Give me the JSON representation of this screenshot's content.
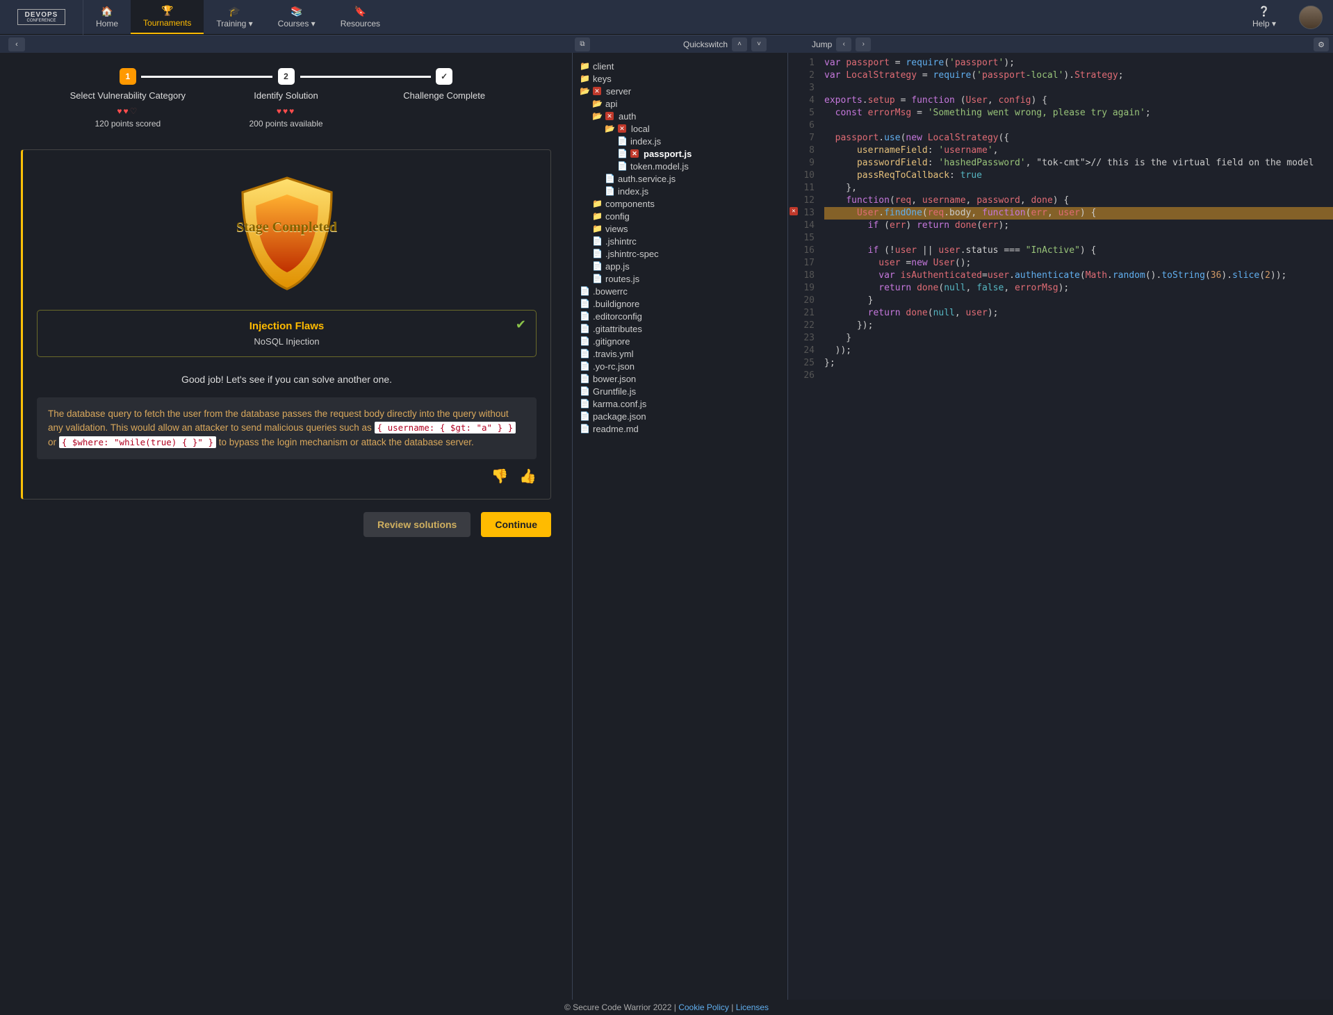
{
  "nav": {
    "logo_top": "DEVOPS",
    "logo_sub": "CONFERENCE",
    "items": [
      {
        "icon": "🏠",
        "label": "Home"
      },
      {
        "icon": "🏆",
        "label": "Tournaments",
        "active": true
      },
      {
        "icon": "🎓",
        "label": "Training ▾"
      },
      {
        "icon": "📚",
        "label": "Courses ▾"
      },
      {
        "icon": "🔖",
        "label": "Resources"
      }
    ],
    "help_label": "Help ▾",
    "help_icon": "❔"
  },
  "toolbar": {
    "back": "‹",
    "popout": "⧉",
    "quickswitch": "Quickswitch",
    "qs_up": "˄",
    "qs_down": "˅",
    "jump": "Jump",
    "jump_prev": "‹",
    "jump_next": "›",
    "gear": "⚙"
  },
  "steps": [
    {
      "num": "1",
      "label": "Select Vulnerability Category",
      "lives_full": 2,
      "lives_empty": 1,
      "sub": "120 points scored"
    },
    {
      "num": "2",
      "label": "Identify Solution",
      "lives_full": 3,
      "lives_empty": 0,
      "sub": "200 points available"
    },
    {
      "num": "✓",
      "label": "Challenge Complete"
    }
  ],
  "challenge": {
    "stage_text": "Stage Completed",
    "result_title": "Injection Flaws",
    "result_sub": "NoSQL Injection",
    "check": "✔",
    "good_job": "Good job! Let's see if you can solve another one.",
    "explain_pre": "The database query to fetch the user from the database passes the request body directly into the query without any validation. This would allow an attacker to send malicious queries such as ",
    "code1": "{ username: { $gt: \"a\" } }",
    "explain_mid": " or ",
    "code2": "{ $where: \"while(true) { }\" }",
    "explain_post": " to bypass the login mechanism or attack the database server.",
    "thumb_down": "👎",
    "thumb_up": "👍",
    "btn_review": "Review solutions",
    "btn_continue": "Continue"
  },
  "tree": {
    "client": "client",
    "keys": "keys",
    "server": "server",
    "api": "api",
    "auth": "auth",
    "local": "local",
    "index_js": "index.js",
    "passport_js": "passport.js",
    "token_model": "token.model.js",
    "auth_service": "auth.service.js",
    "index_js2": "index.js",
    "components": "components",
    "config": "config",
    "views": "views",
    "jshintrc": ".jshintrc",
    "jshintrc_spec": ".jshintrc-spec",
    "app_js": "app.js",
    "routes_js": "routes.js",
    "bowerrc": ".bowerrc",
    "buildignore": ".buildignore",
    "editorconfig": ".editorconfig",
    "gitattributes": ".gitattributes",
    "gitignore": ".gitignore",
    "travis": ".travis.yml",
    "yorc": ".yo-rc.json",
    "bower_json": "bower.json",
    "gruntfile": "Gruntfile.js",
    "karma": "karma.conf.js",
    "package_json": "package.json",
    "readme": "readme.md"
  },
  "code": {
    "lines": [
      "var passport = require('passport');",
      "var LocalStrategy = require('passport-local').Strategy;",
      "",
      "exports.setup = function (User, config) {",
      "  const errorMsg = 'Something went wrong, please try again';",
      "",
      "  passport.use(new LocalStrategy({",
      "      usernameField: 'username',",
      "      passwordField: 'hashedPassword', // this is the virtual field on the model",
      "      passReqToCallback: true",
      "    },",
      "    function(req, username, password, done) {",
      "      User.findOne(req.body, function(err, user) {",
      "        if (err) return done(err);",
      "",
      "        if (!user || user.status === \"InActive\") {",
      "          user =new User();",
      "          var isAuthenticated=user.authenticate(Math.random().toString(36).slice(2));",
      "          return done(null, false, errorMsg);",
      "        }",
      "        return done(null, user);",
      "      });",
      "    }",
      "  ));",
      "};",
      ""
    ],
    "highlight_line": 13,
    "error_line": 13
  },
  "footer": {
    "copy": "© Secure Code Warrior 2022 | ",
    "cookie": "Cookie Policy",
    "sep": " | ",
    "licenses": "Licenses"
  }
}
